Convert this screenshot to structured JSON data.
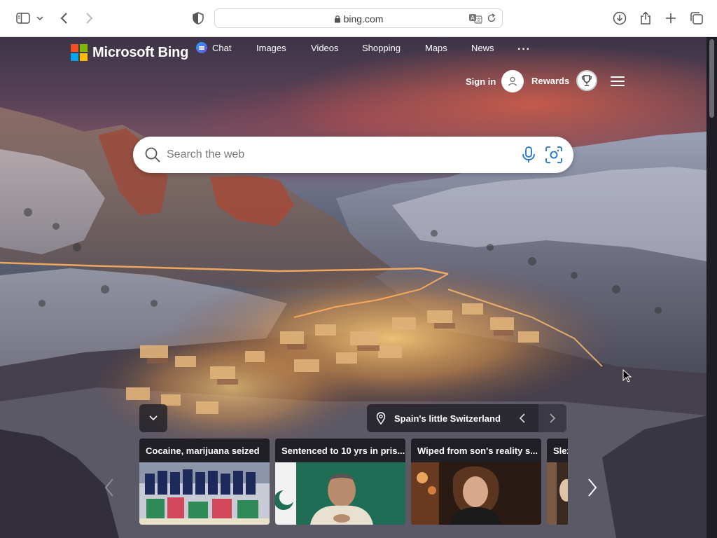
{
  "browser": {
    "address": "bing.com",
    "buttons": {
      "sidebar": "sidebar-icon",
      "back": "chevron-left-icon",
      "forward": "chevron-right-icon",
      "privacy": "shield-icon",
      "translate": "translate-icon",
      "reload": "reload-icon",
      "downloads": "download-icon",
      "share": "share-icon",
      "new_tab": "plus-icon",
      "tabs": "tabs-overview-icon"
    }
  },
  "bing": {
    "logo": "Microsoft Bing",
    "nav": {
      "chat": "Chat",
      "images": "Images",
      "videos": "Videos",
      "shopping": "Shopping",
      "maps": "Maps",
      "news": "News",
      "more": "···"
    },
    "sign_in": "Sign in",
    "rewards": "Rewards",
    "search": {
      "placeholder": "Search the web"
    },
    "image_of_day": {
      "title": "Spain's little Switzerland"
    },
    "news": [
      {
        "title": "Cocaine, marijuana seized"
      },
      {
        "title": "Sentenced to 10 yrs in pris..."
      },
      {
        "title": "Wiped from son's reality s..."
      },
      {
        "title": "Slez"
      }
    ]
  },
  "colors": {
    "ms_red": "#f25022",
    "ms_green": "#7fba00",
    "ms_blue": "#00a4ef",
    "ms_yellow": "#ffb900"
  }
}
